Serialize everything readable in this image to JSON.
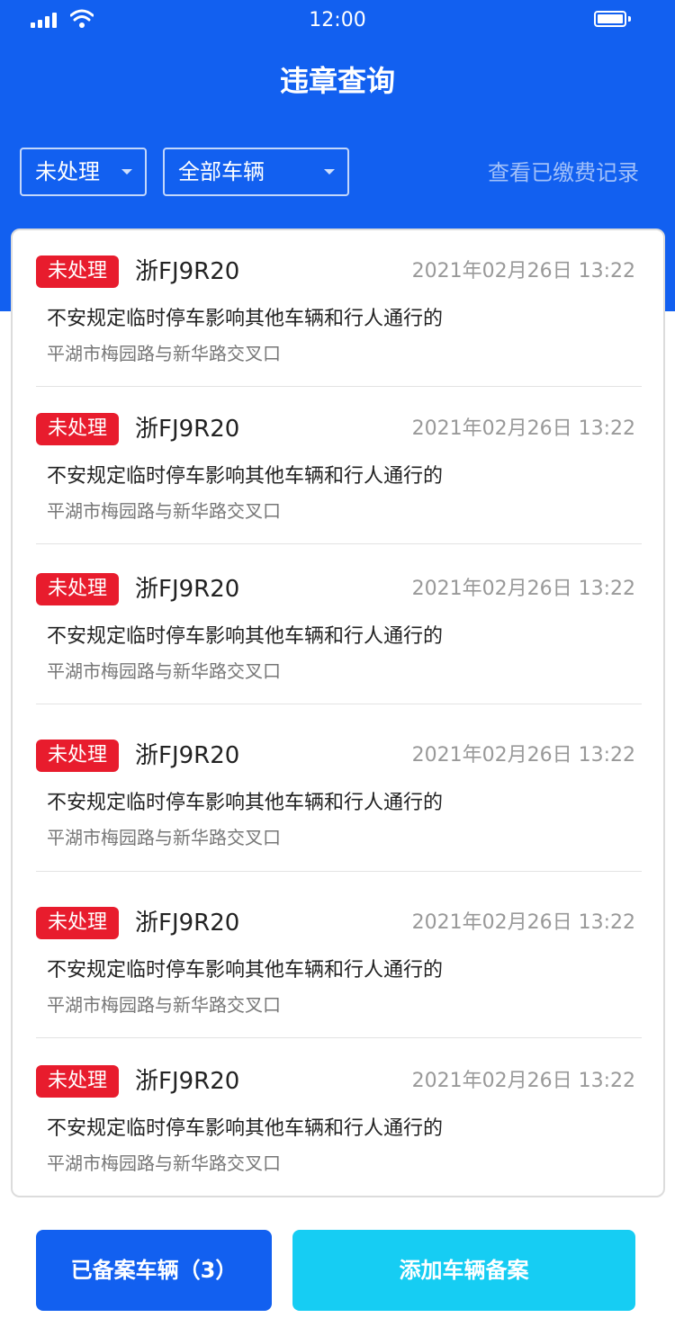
{
  "status_bar": {
    "time": "12:00"
  },
  "header": {
    "title": "违章查询"
  },
  "filters": {
    "status_select": "未处理",
    "vehicle_select": "全部车辆",
    "fee_record_link": "查看已缴费记录"
  },
  "violations": [
    {
      "status": "未处理",
      "plate": "浙FJ9R20",
      "time": "2021年02月26日  13:22",
      "description": "不安规定临时停车影响其他车辆和行人通行的",
      "location": "平湖市梅园路与新华路交叉口"
    },
    {
      "status": "未处理",
      "plate": "浙FJ9R20",
      "time": "2021年02月26日  13:22",
      "description": "不安规定临时停车影响其他车辆和行人通行的",
      "location": "平湖市梅园路与新华路交叉口"
    },
    {
      "status": "未处理",
      "plate": "浙FJ9R20",
      "time": "2021年02月26日  13:22",
      "description": "不安规定临时停车影响其他车辆和行人通行的",
      "location": "平湖市梅园路与新华路交叉口"
    },
    {
      "status": "未处理",
      "plate": "浙FJ9R20",
      "time": "2021年02月26日  13:22",
      "description": "不安规定临时停车影响其他车辆和行人通行的",
      "location": "平湖市梅园路与新华路交叉口"
    },
    {
      "status": "未处理",
      "plate": "浙FJ9R20",
      "time": "2021年02月26日  13:22",
      "description": "不安规定临时停车影响其他车辆和行人通行的",
      "location": "平湖市梅园路与新华路交叉口"
    },
    {
      "status": "未处理",
      "plate": "浙FJ9R20",
      "time": "2021年02月26日  13:22",
      "description": "不安规定临时停车影响其他车辆和行人通行的",
      "location": "平湖市梅园路与新华路交叉口"
    }
  ],
  "actions": {
    "registered_vehicles_label": "已备案车辆（3）",
    "add_vehicle_label": "添加车辆备案"
  },
  "colors": {
    "primary": "#1260f0",
    "accent": "#16cdf3",
    "badge": "#e81c2d"
  },
  "icons": {
    "signal": "signal-icon",
    "wifi": "wifi-icon",
    "battery": "battery-icon",
    "dropdown": "caret-down-icon"
  }
}
